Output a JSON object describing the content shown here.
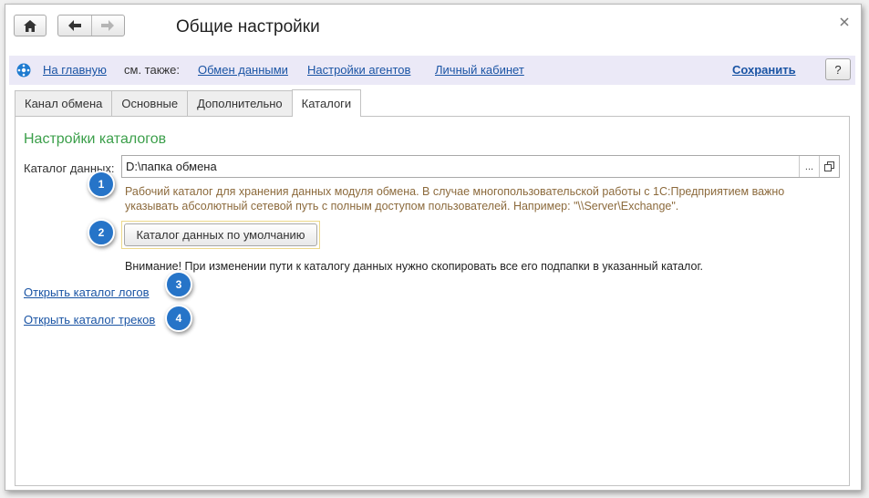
{
  "window": {
    "title": "Общие настройки",
    "close_icon": "close-icon"
  },
  "toolbar": {
    "home_icon": "home-icon",
    "back_icon": "arrow-left-icon",
    "forward_icon": "arrow-right-icon"
  },
  "command_bar": {
    "home_link": "На главную",
    "see_also": "см. также:",
    "links": [
      "Обмен данными",
      "Настройки агентов",
      "Личный кабинет"
    ],
    "save_label": "Сохранить",
    "help_label": "?"
  },
  "tabs": [
    {
      "label": "Канал обмена",
      "active": false
    },
    {
      "label": "Основные",
      "active": false
    },
    {
      "label": "Дополнительно",
      "active": false
    },
    {
      "label": "Каталоги",
      "active": true
    }
  ],
  "panel": {
    "section_title": "Настройки каталогов",
    "data_dir_label": "Каталог данных:",
    "data_dir_value": "D:\\папка обмена",
    "choose_button": "...",
    "open_icon": "open-window-icon",
    "hint": "Рабочий каталог для хранения данных модуля обмена. В случае многопользовательской работы с 1С:Предприятием важно указывать абсолютный сетевой путь с полным доступом пользователей. Например: \"\\\\Server\\Exchange\".",
    "default_button": "Каталог данных по умолчанию",
    "warning": "Внимание! При изменении пути к каталогу данных нужно скопировать все его подпапки в указанный каталог.",
    "open_logs_link": "Открыть каталог логов",
    "open_tracks_link": "Открыть каталог треков"
  },
  "callouts": [
    "1",
    "2",
    "3",
    "4"
  ],
  "colors": {
    "accent_green": "#3b9f4a",
    "link_blue": "#1a54a4",
    "callout_blue": "#2674c8",
    "hint_brown": "#8c6a3c",
    "command_bar_bg": "#ebe9f7"
  }
}
